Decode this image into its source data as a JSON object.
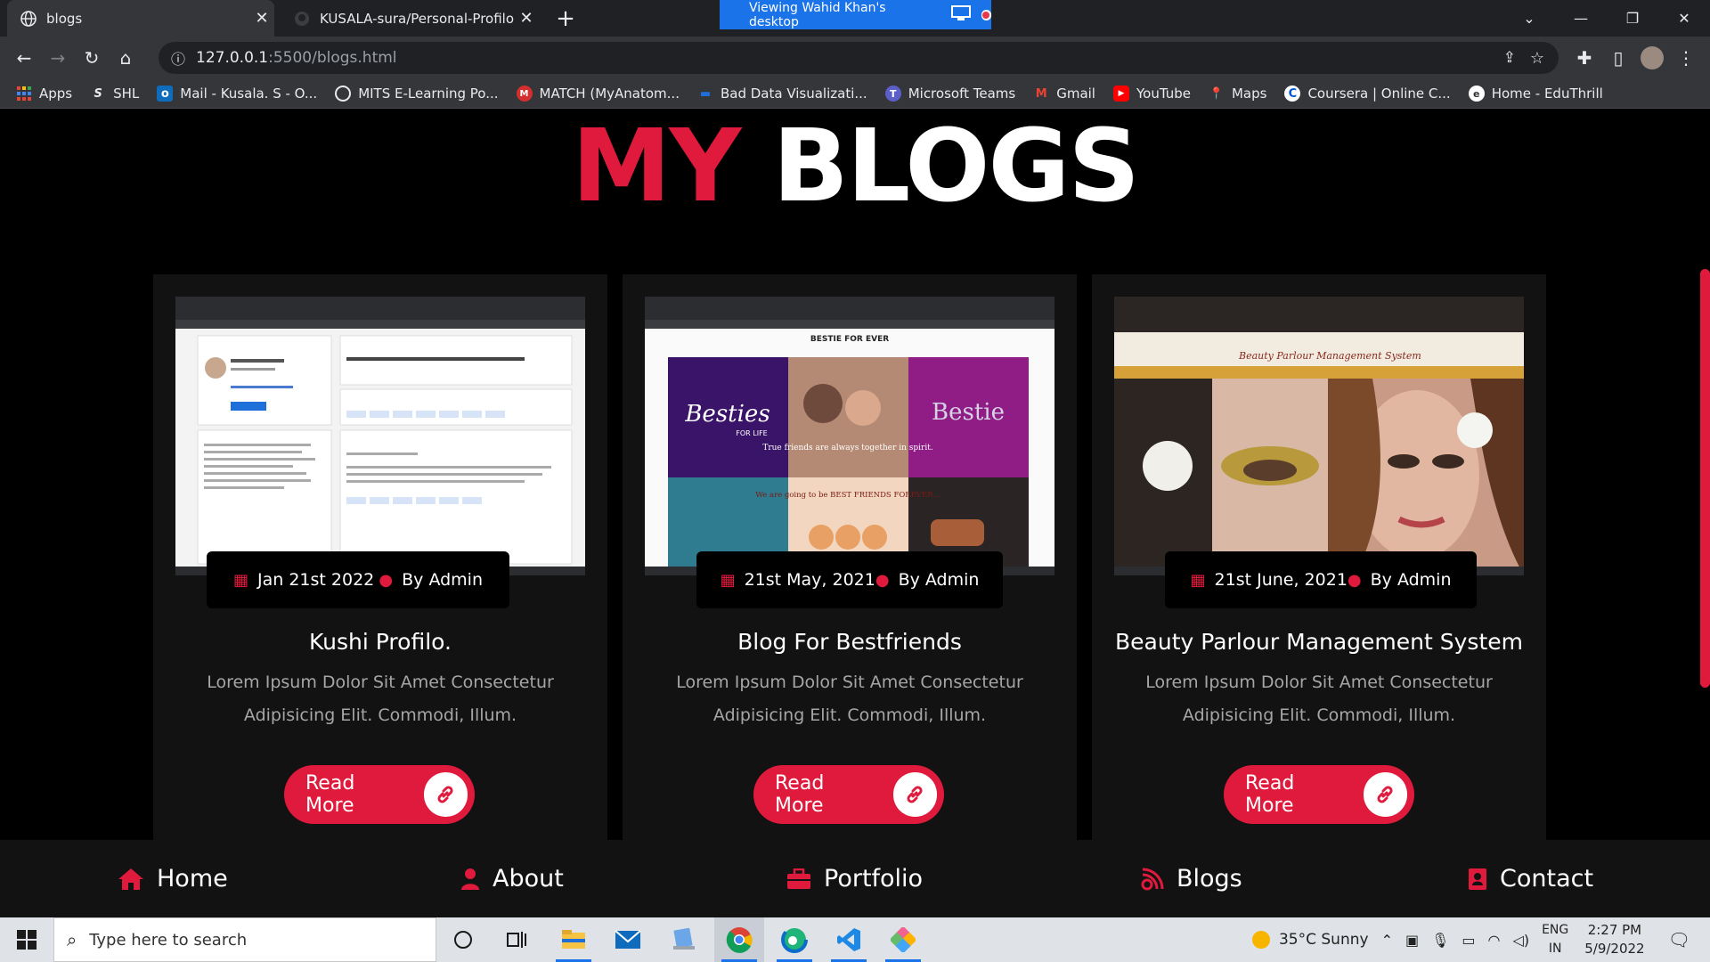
{
  "browser": {
    "tabs": [
      {
        "title": "blogs",
        "active": true
      },
      {
        "title": "KUSALA-sura/Personal-Profilo-Fc",
        "active": false
      }
    ],
    "share_banner": "Viewing Wahid Khan's desktop",
    "url_host": "127.0.0.1",
    "url_rest": ":5500/blogs.html",
    "bookmarks": [
      {
        "label": "Apps",
        "icon": "apps-grid-icon"
      },
      {
        "label": "SHL",
        "icon": "shl-icon"
      },
      {
        "label": "Mail - Kusala. S - O...",
        "icon": "outlook-icon"
      },
      {
        "label": "MITS E-Learning Po...",
        "icon": "globe-icon"
      },
      {
        "label": "MATCH (MyAnatom...",
        "icon": "match-icon"
      },
      {
        "label": "Bad Data Visualizati...",
        "icon": "bookmark-icon"
      },
      {
        "label": "Microsoft Teams",
        "icon": "teams-icon"
      },
      {
        "label": "Gmail",
        "icon": "gmail-icon"
      },
      {
        "label": "YouTube",
        "icon": "youtube-icon"
      },
      {
        "label": "Maps",
        "icon": "maps-icon"
      },
      {
        "label": "Coursera | Online C...",
        "icon": "coursera-icon"
      },
      {
        "label": "Home - EduThrill",
        "icon": "eduthrill-icon"
      }
    ]
  },
  "page": {
    "heading_red": "MY",
    "heading_white": "BLOGS",
    "accent": "#e01a3c",
    "cards": [
      {
        "date": "Jan 21st 2022",
        "author": "By Admin",
        "title": "Kushi Profilo.",
        "desc": "Lorem Ipsum Dolor Sit Amet Consectetur Adipisicing Elit. Commodi, Illum.",
        "button": "Read More"
      },
      {
        "date": "21st May, 2021",
        "author": "By Admin",
        "title": "Blog For Bestfriends",
        "desc": "Lorem Ipsum Dolor Sit Amet Consectetur Adipisicing Elit. Commodi, Illum.",
        "button": "Read More",
        "thumb_caption": "BESTIE FOR EVER",
        "thumb_texts": [
          "Besties",
          "FOR LIFE",
          "True friends are always together in spirit.",
          "Bestie",
          "We are going to be BEST FRIENDS FOREVER..."
        ]
      },
      {
        "date": "21st June, 2021",
        "author": "By Admin",
        "title": "Beauty Parlour Management System",
        "desc": "Lorem Ipsum Dolor Sit Amet Consectetur Adipisicing Elit. Commodi, Illum.",
        "button": "Read More",
        "thumb_caption": "Beauty Parlour Management System"
      }
    ],
    "nav": [
      {
        "label": "Home",
        "icon": "home-icon"
      },
      {
        "label": "About",
        "icon": "user-icon"
      },
      {
        "label": "Portfolio",
        "icon": "briefcase-icon"
      },
      {
        "label": "Blogs",
        "icon": "blog-icon"
      },
      {
        "label": "Contact",
        "icon": "address-book-icon"
      }
    ]
  },
  "taskbar": {
    "search_placeholder": "Type here to search",
    "weather": "35°C  Sunny",
    "lang_top": "ENG",
    "lang_bottom": "IN",
    "time": "2:27 PM",
    "date": "5/9/2022"
  }
}
